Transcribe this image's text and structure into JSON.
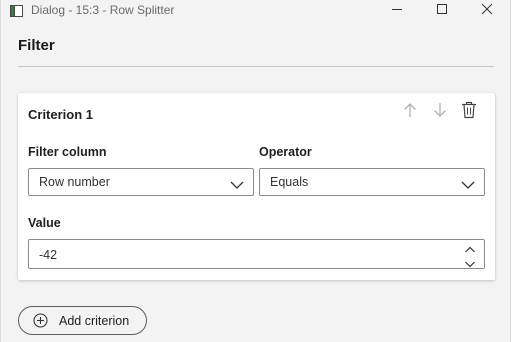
{
  "window": {
    "title": "Dialog - 15:3 - Row Splitter",
    "icons": {
      "app": "app-window-icon",
      "minimize": "minimize-icon",
      "maximize": "maximize-icon",
      "close": "close-icon"
    }
  },
  "filter": {
    "heading": "Filter"
  },
  "criterion": {
    "title": "Criterion 1",
    "actions": {
      "move_up": "arrow-up-icon",
      "move_down": "arrow-down-icon",
      "delete": "trash-icon"
    },
    "filter_column": {
      "label": "Filter column",
      "value": "Row number"
    },
    "operator": {
      "label": "Operator",
      "value": "Equals"
    },
    "value": {
      "label": "Value",
      "value": "-42"
    }
  },
  "add_criterion": {
    "label": "Add criterion",
    "icon": "plus-circle-icon"
  },
  "colors": {
    "background": "#f3f3f3",
    "card": "#ffffff",
    "border": "#8c8c8c",
    "disabled_icon": "#b0b0b0"
  }
}
